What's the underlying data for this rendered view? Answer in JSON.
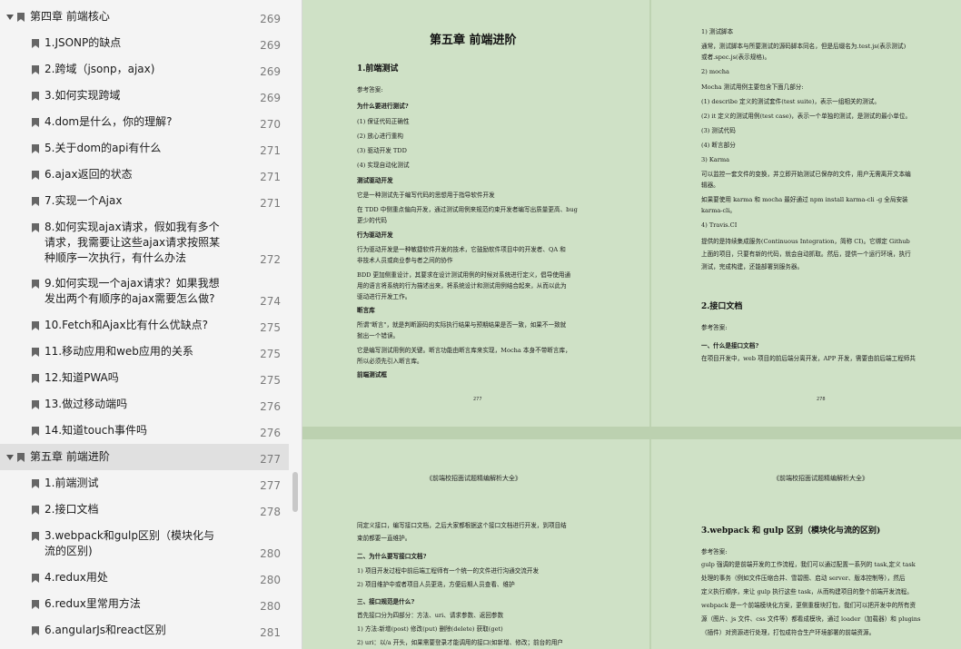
{
  "toc": [
    {
      "label": "第四章 前端核心",
      "page": "269",
      "level": 0
    },
    {
      "label": "1.JSONP的缺点",
      "page": "269",
      "level": 1
    },
    {
      "label": "2.跨域（jsonp，ajax)",
      "page": "269",
      "level": 1
    },
    {
      "label": "3.如何实现跨域",
      "page": "269",
      "level": 1
    },
    {
      "label": "4.dom是什么，你的理解?",
      "page": "270",
      "level": 1
    },
    {
      "label": "5.关于dom的api有什么",
      "page": "271",
      "level": 1
    },
    {
      "label": "6.ajax返回的状态",
      "page": "271",
      "level": 1
    },
    {
      "label": "7.实现一个Ajax",
      "page": "271",
      "level": 1
    },
    {
      "label": "8.如何实现ajax请求，假如我有多个请求，我需要让这些ajax请求按照某种顺序一次执行，有什么办法",
      "lines": [
        "8.如何实现ajax请求，假如我有多个",
        "请求，我需要让这些ajax请求按照某",
        "种顺序一次执行，有什么办法"
      ],
      "page": "272",
      "level": 1
    },
    {
      "label": "9.如何实现一个ajax请求？如果我想发出两个有顺序的ajax需要怎么做?",
      "lines": [
        "9.如何实现一个ajax请求？如果我想",
        "发出两个有顺序的ajax需要怎么做?"
      ],
      "page": "274",
      "level": 1
    },
    {
      "label": "10.Fetch和Ajax比有什么优缺点?",
      "page": "275",
      "level": 1
    },
    {
      "label": "11.移动应用和web应用的关系",
      "page": "275",
      "level": 1
    },
    {
      "label": "12.知道PWA吗",
      "page": "275",
      "level": 1
    },
    {
      "label": "13.做过移动端吗",
      "page": "276",
      "level": 1
    },
    {
      "label": "14.知道touch事件吗",
      "page": "276",
      "level": 1
    },
    {
      "label": "第五章 前端进阶",
      "page": "277",
      "level": 0,
      "selected": true
    },
    {
      "label": "1.前端测试",
      "page": "277",
      "level": 1
    },
    {
      "label": "2.接口文档",
      "page": "278",
      "level": 1
    },
    {
      "label": "3.webpack和gulp区别（模块化与流的区别)",
      "lines": [
        "3.webpack和gulp区别（模块化与",
        "流的区别)"
      ],
      "page": "280",
      "level": 1
    },
    {
      "label": "4.redux用处",
      "page": "280",
      "level": 1
    },
    {
      "label": "6.redux里常用方法",
      "page": "280",
      "level": 1
    },
    {
      "label": "6.angularJs和react区别",
      "page": "281",
      "level": 1
    }
  ],
  "page277": {
    "title": "第五章  前端进阶",
    "section": "1.前端测试",
    "answer": "参考答案:",
    "why": "为什么要进行测试?",
    "items": [
      "(1) 保证代码正确性",
      "(2) 放心进行重构",
      "(3) 驱动开发 TDD",
      "(4) 实现自动化测试"
    ],
    "tdd_h": "测试驱动开发",
    "tdd_1": "它是一种测试先于编写代码的思想用于指导软件开发",
    "tdd_2a": "在 TDD 中侧重点偏向开发，通过测试用例来规范约束开发者编写出质量更高、bug",
    "tdd_2b": "更少的代码",
    "bdd_h": "行为驱动开发",
    "bdd_1a": "行为驱动开发是一种敏捷软件开发的技术，它鼓励软件项目中的开发者、QA 和",
    "bdd_1b": "非技术人员或商业参与者之间的协作",
    "bdd_2a": "BDD 更加侧重设计，其要求在设计测试用例的时候对系统进行定义，倡导使用通",
    "bdd_2b": "用的语言将系统的行为描述出来，将系统设计和测试用例结合起来，从而以此为",
    "bdd_2c": "驱动进行开发工作。",
    "assert_h": "断言库",
    "assert_1a": "所谓\"断言\"，就是判断源码的实际执行结果与预期结果是否一致，如果不一致就",
    "assert_1b": "抛出一个错误。",
    "assert_2a": "它是编写测试用例的关键。断言功能由断言库来实现，Mocha 本身不带断言库，",
    "assert_2b": "所以必须先引入断言库。",
    "framework_h": "前端测试框",
    "pageno": "277"
  },
  "page278": {
    "l1": "1) 测试脚本",
    "l2a": "通常，测试脚本与所要测试的源码脚本同名，但是后缀名为.test.js(表示测试)",
    "l2b": "或者.spec.js(表示规格)。",
    "l3": "2) mocha",
    "l4": "Mocha 测试用例主要包含下面几部分:",
    "l5": "(1) describe 定义的测试套件(test suite)，表示一组相关的测试。",
    "l6": "(2) it 定义的测试用例(test case)，表示一个单独的测试，是测试的最小单位。",
    "l7": "(3) 测试代码",
    "l8": "(4) 断言部分",
    "l9": "3) Karma",
    "l10a": "可以监控一套文件的变换，并立即开始测试已保存的文件，用户无需离开文本编",
    "l10b": "辑器。",
    "l11a": "如果要使用 karma 和 mocha 最好通过 npm install karma-cli -g 全局安装",
    "l11b": "karma-cli。",
    "l12": "4) Travis.CI",
    "l13a": "提供的是持续集成服务(Continuous Integration，简称 CI)。它绑定 Github",
    "l13b": "上面的项目，只要有新的代码，就会自动抓取。然后，提供一个运行环境，执行",
    "l13c": "测试，完成构建，还能部署到服务器。",
    "section": "2.接口文档",
    "answer": "参考答案:",
    "what": "一、什么是接口文档?",
    "what_1": "在项目开发中，web 项目的前后端分离开发，APP 开发，需要由前后端工程师共",
    "pageno": "278"
  },
  "page279": {
    "header": "《前端校招面试题精编解析大全》",
    "l1": "同定义接口，编写接口文档，之后大家都根据这个接口文档进行开发，到项目结",
    "l2": "束前都要一直维护。",
    "h2": "二、为什么要写接口文档?",
    "l3": "1) 项目开发过程中前后端工程师有一个统一的文件进行沟通交流开发",
    "l4": "2) 项目维护中或者项目人员更迭，方便后期人员查看、维护",
    "h3": "三、接口规范是什么?",
    "l5": "首先接口分为四部分：方法、uri、请求参数、返回参数",
    "l6": "1) 方法:新增(post) 修改(put) 删除(delete) 获取(get)",
    "l7": "2) uri：以/a 开头，如果需要登录才能调用的接口(如新增、修改；前台的用户"
  },
  "page280": {
    "header": "《前端校招面试题精编解析大全》",
    "section": "3.webpack 和 gulp 区别（模块化与流的区别)",
    "answer": "参考答案:",
    "l1": "gulp 强调的是前端开发的工作流程，我们可以通过配置一系列的 task,定义 task",
    "l2": "处理的事务（例如文件压缩合并、雪碧图、启动 server、版本控制等），然后",
    "l3": "定义执行顺序，来让 gulp 执行这些 task，从而构建项目的整个前端开发流程。",
    "l4": "webpack 是一个前端模块化方案，更侧重模块打包，我们可以把开发中的所有资",
    "l5": "源（图片、js 文件、css 文件等）都看成模块，通过 loader（加载器）和 plugins",
    "l6": "（插件）对资源进行处理，打包成符合生产环境部署的前端资源。"
  }
}
